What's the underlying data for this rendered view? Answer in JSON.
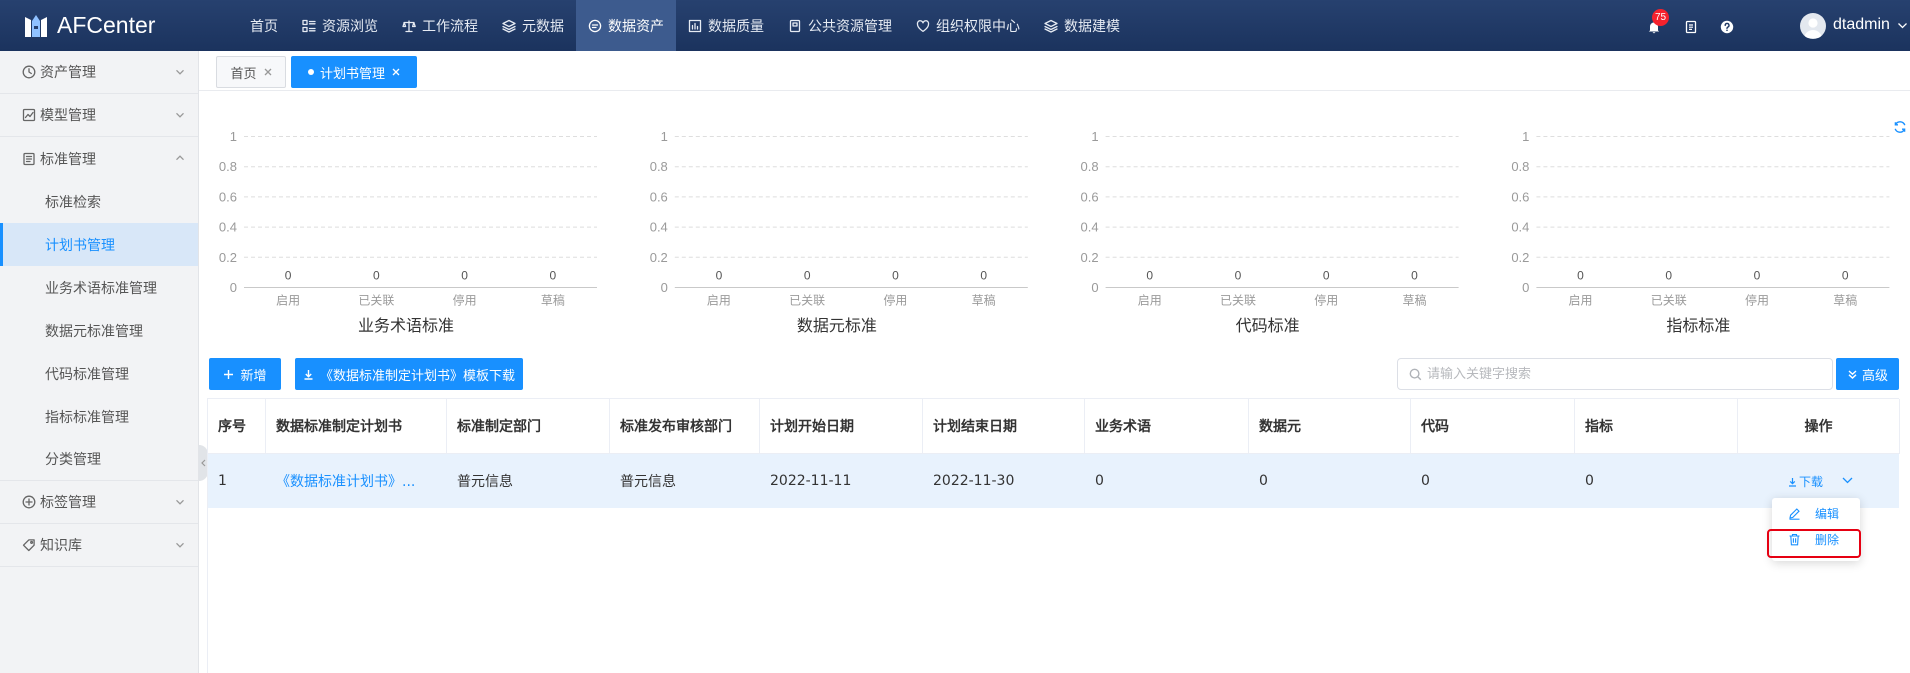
{
  "app": {
    "name": "AFCenter",
    "logo_icon": "afcenter-logo-icon"
  },
  "colors": {
    "primary": "#1890ff",
    "nav_background": "#1d3662",
    "nav_active": "#3d5b8e",
    "badge": "#f5222d",
    "row_selected": "#e8f2fd",
    "highlight_outline": "#e60012"
  },
  "topnav": {
    "items": [
      {
        "label": "首页",
        "icon": ""
      },
      {
        "label": "资源浏览",
        "icon": "list-grid-icon"
      },
      {
        "label": "工作流程",
        "icon": "balance-icon"
      },
      {
        "label": "元数据",
        "icon": "layers-icon"
      },
      {
        "label": "数据资产",
        "icon": "chat-circle-icon",
        "active": true
      },
      {
        "label": "数据质量",
        "icon": "bar-chart-icon"
      },
      {
        "label": "公共资源管理",
        "icon": "document-icon"
      },
      {
        "label": "组织权限中心",
        "icon": "heart-icon"
      },
      {
        "label": "数据建模",
        "icon": "layers-icon"
      }
    ],
    "notification_count": "75",
    "right_icons": [
      "bell-icon",
      "document-list-icon",
      "help-icon"
    ],
    "username": "dtadmin"
  },
  "sidebar": {
    "groups": [
      {
        "label": "资产管理",
        "icon": "clock-icon",
        "expanded": false
      },
      {
        "label": "模型管理",
        "icon": "line-chart-icon",
        "expanded": false
      },
      {
        "label": "标准管理",
        "icon": "document-list-icon",
        "expanded": true,
        "children": [
          "标准检索",
          "计划书管理",
          "业务术语标准管理",
          "数据元标准管理",
          "代码标准管理",
          "指标标准管理",
          "分类管理"
        ],
        "active_child": "计划书管理"
      },
      {
        "label": "标签管理",
        "icon": "plus-circle-icon",
        "expanded": false
      },
      {
        "label": "知识库",
        "icon": "tag-icon",
        "expanded": false
      }
    ]
  },
  "tabs": [
    {
      "label": "首页",
      "active": false
    },
    {
      "label": "计划书管理",
      "active": true
    }
  ],
  "toolbar": {
    "add_label": "新增",
    "template_download_label": "《数据标准制定计划书》模板下载",
    "search_placeholder": "请输入关键字搜索",
    "advanced_label": "高级"
  },
  "table": {
    "columns": [
      "序号",
      "数据标准制定计划书",
      "标准制定部门",
      "标准发布审核部门",
      "计划开始日期",
      "计划结束日期",
      "业务术语",
      "数据元",
      "代码",
      "指标",
      "操作"
    ],
    "rows": [
      {
        "cells": [
          "1",
          "《数据标准计划书》...",
          "普元信息",
          "普元信息",
          "2022-11-11",
          "2022-11-30",
          "0",
          "0",
          "0",
          "0"
        ],
        "selected": true
      }
    ],
    "row_actions": {
      "download_label": "下载",
      "menu": [
        "编辑",
        "删除"
      ],
      "highlighted": "删除"
    }
  },
  "chart_data": [
    {
      "type": "bar",
      "title": "业务术语标准",
      "categories": [
        "启用",
        "已关联",
        "停用",
        "草稿"
      ],
      "values": [
        0,
        0,
        0,
        0
      ],
      "ylim": [
        0,
        1
      ],
      "yticks": [
        0,
        0.2,
        0.4,
        0.6,
        0.8,
        1
      ],
      "grid": true,
      "data_labels": true
    },
    {
      "type": "bar",
      "title": "数据元标准",
      "categories": [
        "启用",
        "已关联",
        "停用",
        "草稿"
      ],
      "values": [
        0,
        0,
        0,
        0
      ],
      "ylim": [
        0,
        1
      ],
      "yticks": [
        0,
        0.2,
        0.4,
        0.6,
        0.8,
        1
      ],
      "grid": true,
      "data_labels": true
    },
    {
      "type": "bar",
      "title": "代码标准",
      "categories": [
        "启用",
        "已关联",
        "停用",
        "草稿"
      ],
      "values": [
        0,
        0,
        0,
        0
      ],
      "ylim": [
        0,
        1
      ],
      "yticks": [
        0,
        0.2,
        0.4,
        0.6,
        0.8,
        1
      ],
      "grid": true,
      "data_labels": true
    },
    {
      "type": "bar",
      "title": "指标标准",
      "categories": [
        "启用",
        "已关联",
        "停用",
        "草稿"
      ],
      "values": [
        0,
        0,
        0,
        0
      ],
      "ylim": [
        0,
        1
      ],
      "yticks": [
        0,
        0.2,
        0.4,
        0.6,
        0.8,
        1
      ],
      "grid": true,
      "data_labels": true
    }
  ]
}
